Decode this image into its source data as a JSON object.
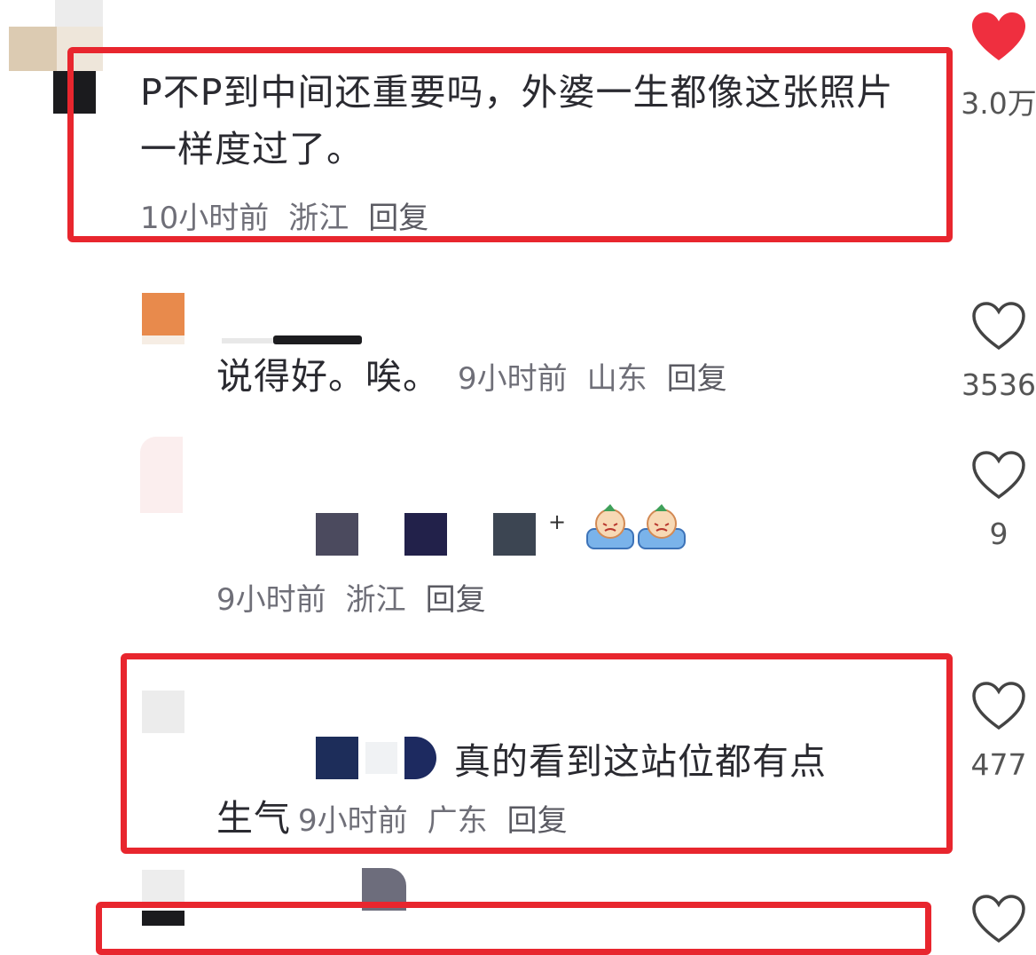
{
  "comments": [
    {
      "text": "P不P到中间还重要吗，外婆一生都像这张照片一样度过了。",
      "time": "10小时前",
      "location": "浙江",
      "reply": "回复",
      "likes": "3.0万",
      "liked": true
    },
    {
      "text": "说得好。唉。",
      "time": "9小时前",
      "location": "山东",
      "reply": "回复",
      "likes": "3536",
      "liked": false
    },
    {
      "text": "",
      "time": "9小时前",
      "location": "浙江",
      "reply": "回复",
      "likes": "9",
      "liked": false
    },
    {
      "text_line1": "真的看到这站位都有点",
      "text_line2": "生气",
      "time": "9小时前",
      "location": "广东",
      "reply": "回复",
      "likes": "477",
      "liked": false
    }
  ],
  "colors": {
    "highlight": "#e8262e",
    "heart_liked": "#ef2f3f",
    "text": "#2a2a30",
    "meta": "#6f6f78"
  },
  "icons": [
    "heart-icon",
    "crying-emoji-icon"
  ]
}
